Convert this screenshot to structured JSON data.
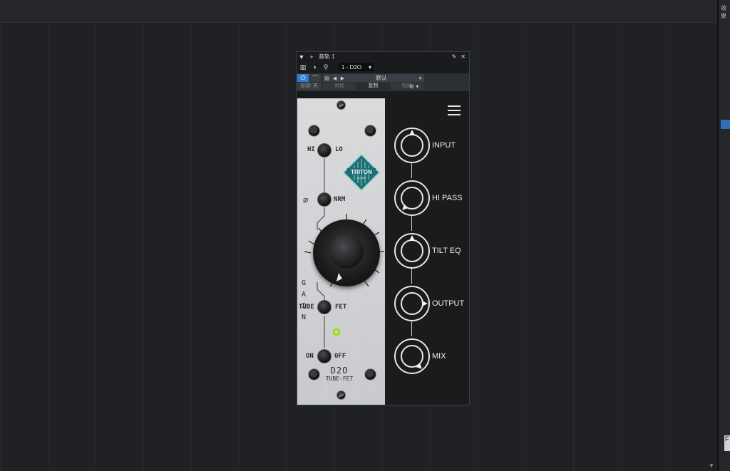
{
  "window": {
    "title": "音轨 1",
    "instrument": "1 - D2O",
    "pin_icon": "pin-icon",
    "close_icon": "close-icon"
  },
  "toolbar": {
    "power_label": "⏻",
    "auto_label": "自动: 关",
    "preset_name": "默认",
    "compare_label": "对比",
    "copy_label": "复制",
    "paste_label": "粘贴"
  },
  "faceplate": {
    "hi_label": "HI",
    "lo_label": "LO",
    "phase_symbol": "∅",
    "nrm_label": "NRM",
    "gain_label": "G\nA\nI\nN",
    "tube_label": "TUBE",
    "fet_label": "FET",
    "on_label": "ON",
    "off_label": "OFF",
    "model_name": "D2O",
    "model_sub": "TUBE-FET",
    "logo_text": "TRITON",
    "logo_sub": "AUDIO"
  },
  "controls": {
    "input": "INPUT",
    "hi_pass": "HI PASS",
    "tilt_eq": "TILT EQ",
    "output": "OUTPUT",
    "mix": "MIX"
  },
  "sidebar": {
    "tab_label": "效果"
  }
}
